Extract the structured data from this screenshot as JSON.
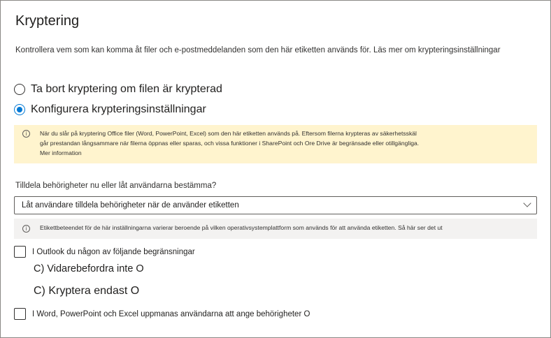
{
  "title": "Kryptering",
  "description": "Kontrollera vem som kan komma åt filer och e-postmeddelanden som den här etiketten används för. Läs mer om krypteringsinställningar",
  "radios": [
    {
      "label": "Ta bort kryptering om filen är krypterad",
      "checked": false
    },
    {
      "label": "Konfigurera krypteringsinställningar",
      "checked": true
    }
  ],
  "warning": {
    "line1": "När du slår på kryptering Office filer (Word, PowerPoint, Excel) som den här etiketten används på. Eftersom filerna krypteras av säkerhetsskäl",
    "line2": "går prestandan långsammare när filerna öppnas eller sparas, och vissa funktioner i SharePoint och Ore Drive är begränsade eller otillgängliga.",
    "link": "Mer information"
  },
  "assign": {
    "question": "Tilldela behörigheter nu eller låt användarna bestämma?",
    "selected": "Låt användare tilldela behörigheter när de använder etiketten",
    "note": "Etikettbeteendet för de här inställningarna varierar beroende på vilken operativsystemplattform som används för att använda etiketten. Så här ser det ut"
  },
  "outlook": {
    "label": "I Outlook du någon av följande begränsningar",
    "checked": false,
    "option1": "C) Vidarebefordra inte O",
    "option2": "C) Kryptera endast O"
  },
  "office": {
    "label": "I Word, PowerPoint och Excel uppmanas användarna att ange behörigheter O",
    "checked": false
  },
  "colors": {
    "accent": "#0078d4",
    "warning_bg": "#fff4ce",
    "note_bg": "#f3f2f1",
    "border": "#605e5c"
  }
}
